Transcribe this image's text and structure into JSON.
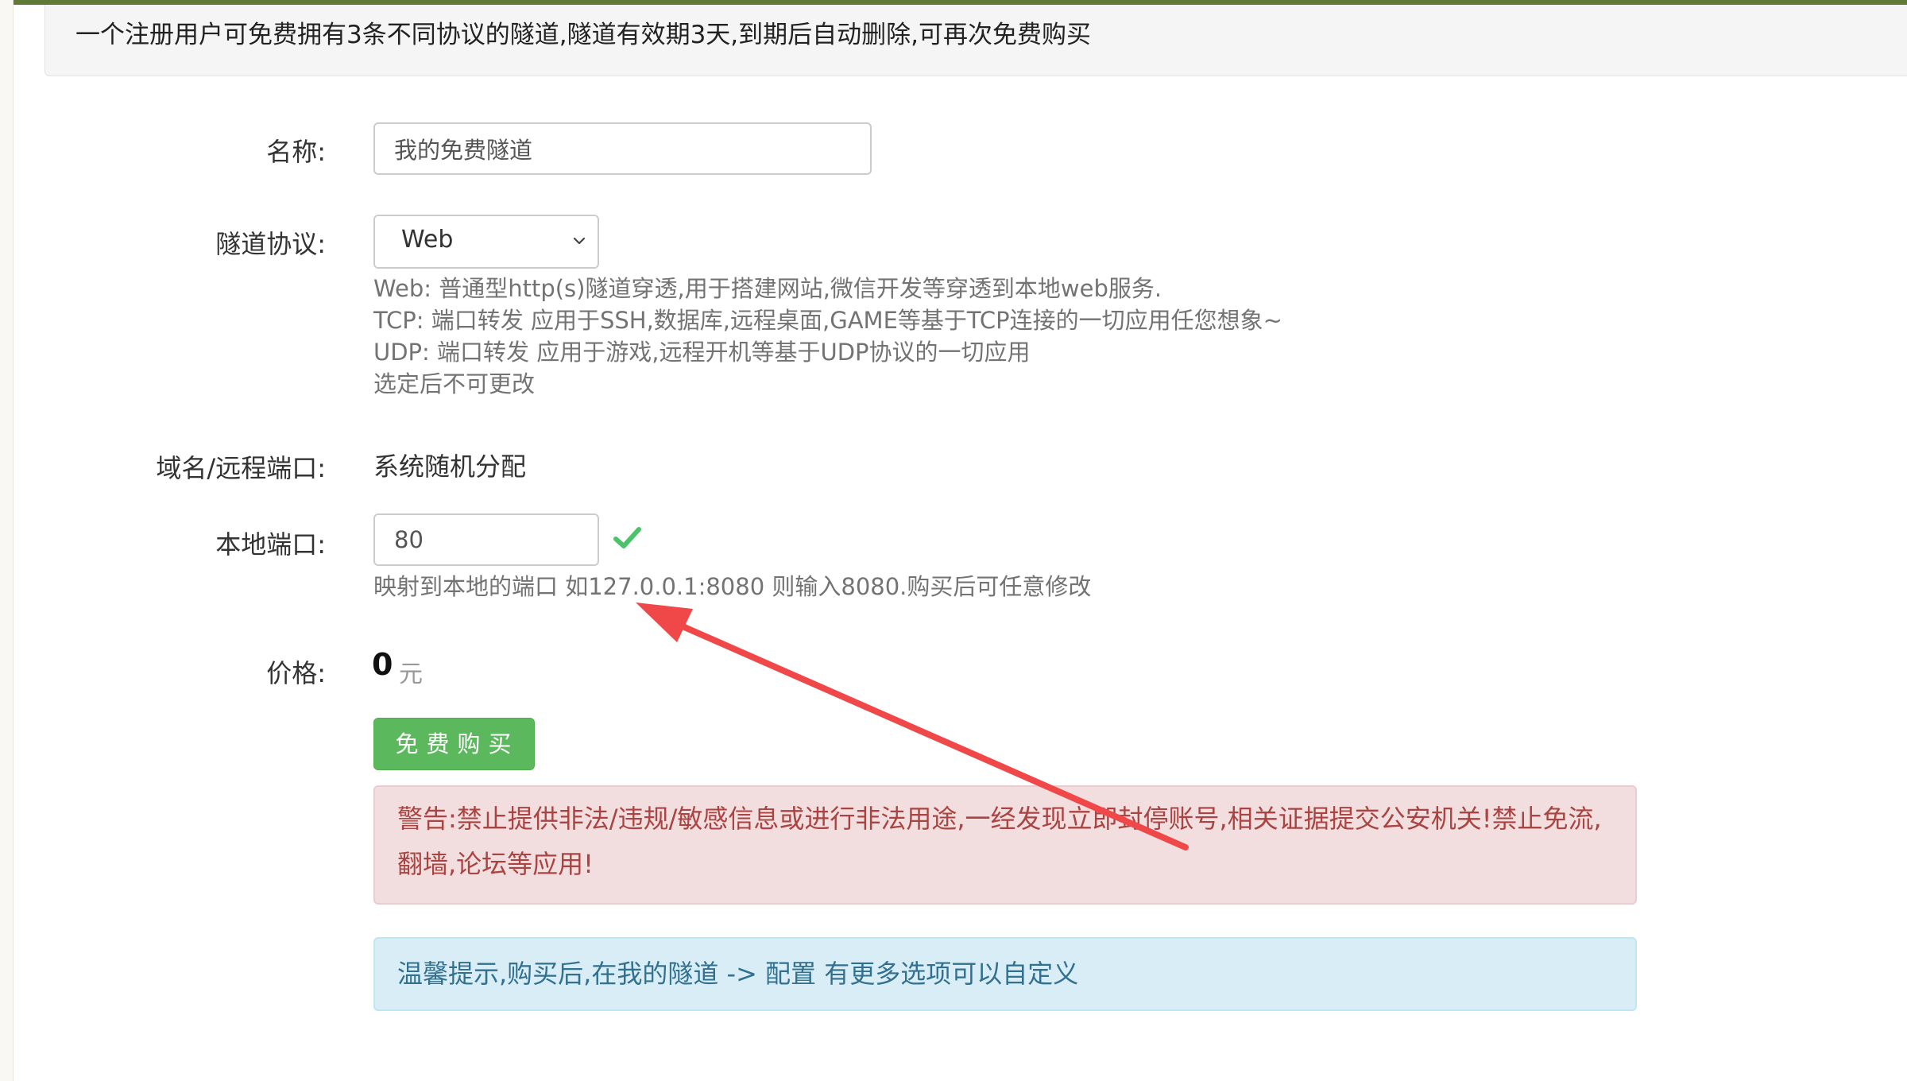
{
  "notice": {
    "text": "一个注册用户可免费拥有3条不同协议的隧道,隧道有效期3天,到期后自动删除,可再次免费购买"
  },
  "form": {
    "name": {
      "label": "名称:",
      "value": "我的免费隧道"
    },
    "protocol": {
      "label": "隧道协议:",
      "selected": "Web",
      "help": [
        "Web: 普通型http(s)隧道穿透,用于搭建网站,微信开发等穿透到本地web服务.",
        "TCP: 端口转发 应用于SSH,数据库,远程桌面,GAME等基于TCP连接的一切应用任您想象~",
        "UDP: 端口转发 应用于游戏,远程开机等基于UDP协议的一切应用",
        "选定后不可更改"
      ]
    },
    "domain": {
      "label": "域名/远程端口:",
      "value": "系统随机分配"
    },
    "local_port": {
      "label": "本地端口:",
      "value": "80",
      "help": "映射到本地的端口 如127.0.0.1:8080 则输入8080.购买后可任意修改"
    },
    "price": {
      "label": "价格:",
      "amount": "0",
      "unit": "元"
    },
    "buy_button": "免费购买"
  },
  "alerts": {
    "warning": "警告:禁止提供非法/违规/敏感信息或进行非法用途,一经发现立即封停账号,相关证据提交公安机关!禁止免流,翻墙,论坛等应用!",
    "info": "温馨提示,购买后,在我的隧道 -> 配置 有更多选项可以自定义"
  },
  "colors": {
    "topbar": "#5f7a34",
    "success": "#5cb85c",
    "check": "#4cc36a",
    "danger_bg": "#f2dede",
    "danger_text": "#a94442",
    "info_bg": "#d9edf7",
    "info_text": "#31708f",
    "annotation_arrow": "#f04848"
  },
  "icons": {
    "select_arrow": "chevron-down-icon",
    "valid": "check-icon",
    "annotation": "arrow-annotation"
  }
}
